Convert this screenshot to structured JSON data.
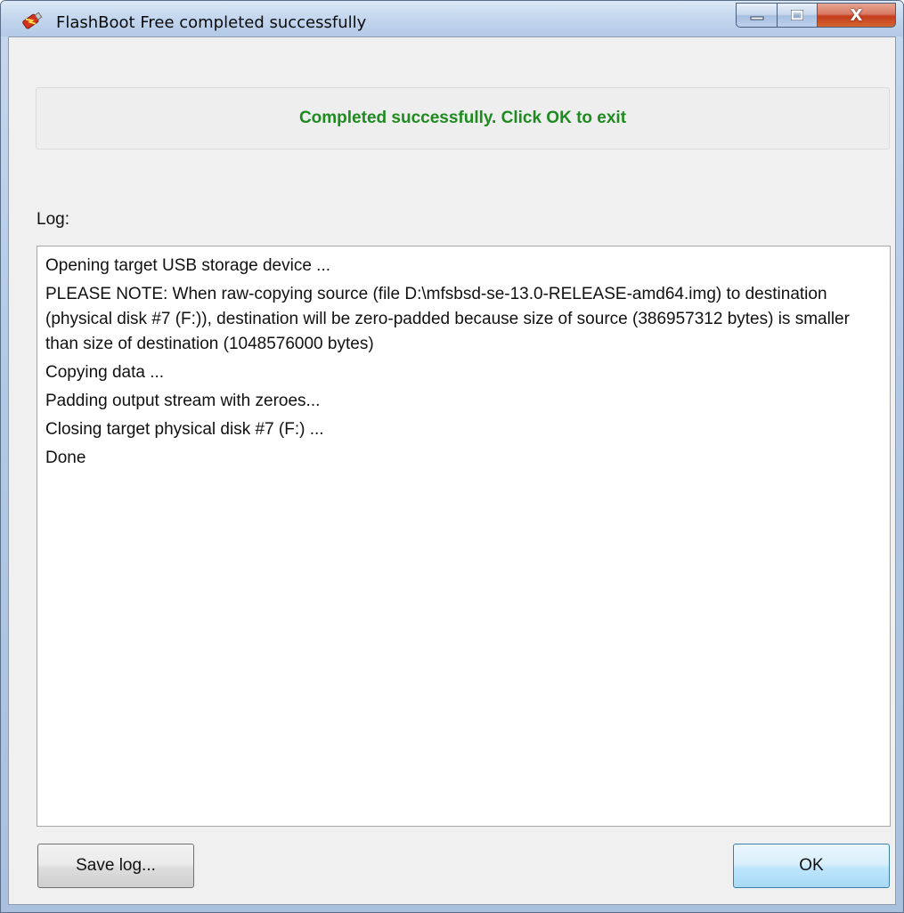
{
  "window": {
    "title": "FlashBoot Free completed successfully",
    "controls": {
      "minimize_icon": "minimize-icon",
      "maximize_icon": "maximize-icon",
      "close_label": "X"
    }
  },
  "status": {
    "message": "Completed successfully. Click OK to exit",
    "color": "#1f8a1f"
  },
  "log": {
    "label": "Log:",
    "lines": [
      "Opening target USB storage device ...",
      "PLEASE NOTE: When raw-copying source (file D:\\mfsbsd-se-13.0-RELEASE-amd64.img) to destination (physical disk #7 (F:)), destination will be zero-padded because size of source (386957312 bytes) is smaller than size of destination (1048576000 bytes)",
      "Copying data ...",
      "Padding output stream with zeroes...",
      "Closing target physical disk #7 (F:) ...",
      "Done"
    ]
  },
  "buttons": {
    "save_log": "Save log...",
    "ok": "OK"
  }
}
